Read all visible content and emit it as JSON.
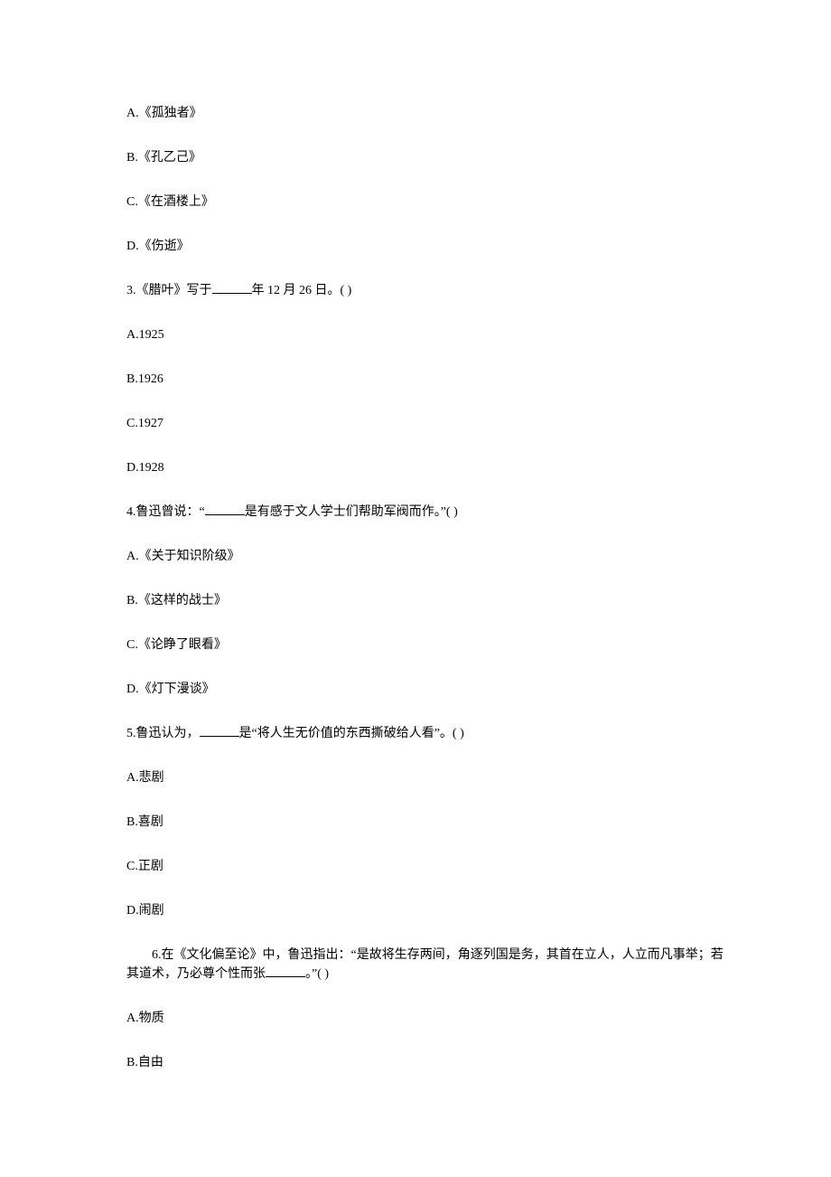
{
  "q2": {
    "options": {
      "a": "A.《孤独者》",
      "b": "B.《孔乙己》",
      "c": "C.《在酒楼上》",
      "d": "D.《伤逝》"
    }
  },
  "q3": {
    "prefix": "3.《腊叶》写于",
    "suffix": "年 12 月 26 日。( )",
    "options": {
      "a": "A.1925",
      "b": "B.1926",
      "c": "C.1927",
      "d": "D.1928"
    }
  },
  "q4": {
    "prefix": "4.鲁迅曾说：“",
    "suffix": "是有感于文人学士们帮助军阀而作。”( )",
    "options": {
      "a": "A.《关于知识阶级》",
      "b": "B.《这样的战士》",
      "c": "C.《论睁了眼看》",
      "d": "D.《灯下漫谈》"
    }
  },
  "q5": {
    "prefix": "5.鲁迅认为，",
    "suffix": "是“将人生无价值的东西撕破给人看”。( )",
    "options": {
      "a": "A.悲剧",
      "b": "B.喜剧",
      "c": "C.正剧",
      "d": "D.闹剧"
    }
  },
  "q6": {
    "prefix": "6.在《文化偏至论》中，鲁迅指出：“是故将生存两间，角逐列国是务，其首在立人，人立而凡事举；若其道术，乃必尊个性而张",
    "suffix": "。”( )",
    "options": {
      "a": "A.物质",
      "b": "B.自由"
    }
  }
}
